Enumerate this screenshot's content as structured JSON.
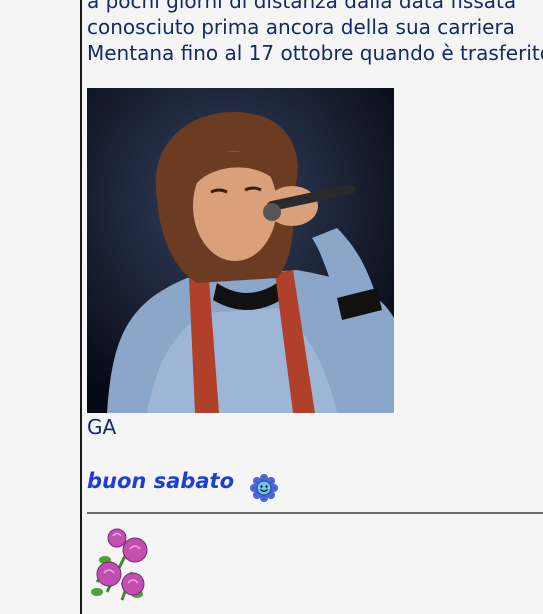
{
  "post": {
    "intro_lines": [
      "a pochi giorni di distanza dalla data fissata",
      "conosciuto prima ancora della sua carriera",
      "Mentana fino al 17 ottobre quando è trasferito"
    ],
    "signature": "GA",
    "greeting": "buon sabato"
  },
  "colors": {
    "text": "#132a66",
    "greeting": "#1d3fd6",
    "background": "#f5f5f5"
  },
  "icons": [
    "smiley-flower-icon",
    "roses-icon"
  ]
}
